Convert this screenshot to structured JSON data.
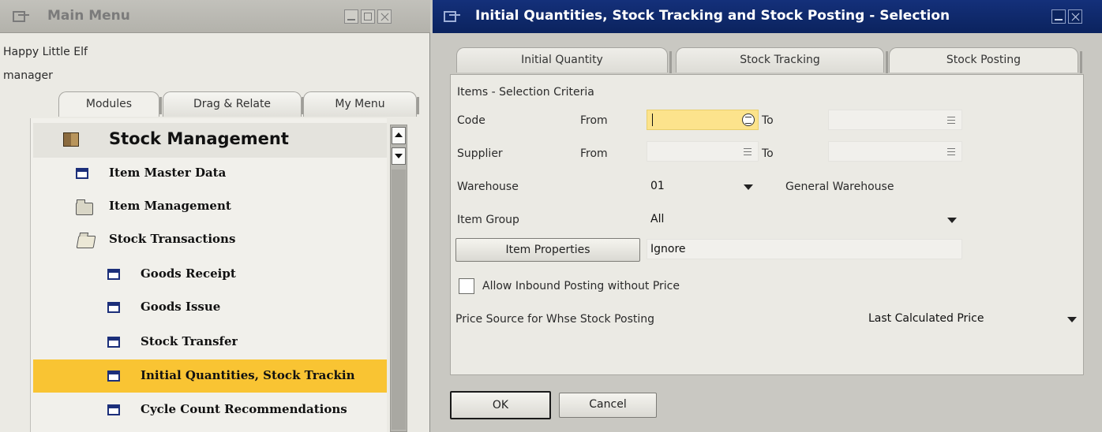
{
  "main_menu": {
    "title": "Main Menu",
    "company": "Happy Little Elf",
    "user": "manager",
    "tabs": [
      "Modules",
      "Drag & Relate",
      "My Menu"
    ],
    "module_header": "Stock Management",
    "items": [
      {
        "label": "Item Master Data"
      },
      {
        "label": "Item Management"
      },
      {
        "label": "Stock Transactions"
      },
      {
        "label": "Goods Receipt"
      },
      {
        "label": "Goods Issue"
      },
      {
        "label": "Stock Transfer"
      },
      {
        "label": "Initial Quantities, Stock Trackin"
      },
      {
        "label": "Cycle Count Recommendations"
      }
    ]
  },
  "selection_window": {
    "title": "Initial Quantities, Stock Tracking and Stock Posting - Selection",
    "tabs": [
      "Initial Quantity",
      "Stock Tracking",
      "Stock Posting"
    ],
    "section_title": "Items - Selection Criteria",
    "code_label": "Code",
    "from_label": "From",
    "to_label": "To",
    "supplier_label": "Supplier",
    "warehouse_label": "Warehouse",
    "warehouse_value": "01",
    "warehouse_name": "General Warehouse",
    "item_group_label": "Item Group",
    "item_group_value": "All",
    "item_properties_button": "Item Properties",
    "item_properties_value": "Ignore",
    "allow_inbound_label": "Allow Inbound Posting without Price",
    "price_source_label": "Price Source for Whse Stock Posting",
    "price_source_value": "Last Calculated Price",
    "ok_button": "OK",
    "cancel_button": "Cancel"
  },
  "colors": {
    "highlight": "#f9c433",
    "focus_field": "#fce38c",
    "active_titlebar": "#0b235e"
  }
}
